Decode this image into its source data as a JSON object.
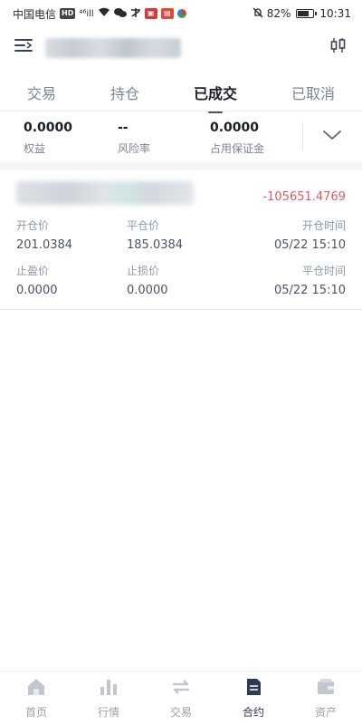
{
  "status_bar": {
    "carrier": "中国电信",
    "hd_badge": "HD",
    "signal_text": "⁴⁶ill",
    "battery": "82%",
    "time": "10:31"
  },
  "tabs": [
    {
      "label": "交易"
    },
    {
      "label": "持仓"
    },
    {
      "label": "已成交",
      "active": true
    },
    {
      "label": "已取消"
    }
  ],
  "summary": {
    "equity": {
      "value": "0.0000",
      "label": "权益"
    },
    "risk_rate": {
      "value": "--",
      "label": "风险率"
    },
    "margin_used": {
      "value": "0.0000",
      "label": "占用保证金"
    }
  },
  "order": {
    "pnl": "-105651.4769",
    "open_price_label": "开仓价",
    "open_price": "201.0384",
    "close_price_label": "平仓价",
    "close_price": "185.0384",
    "open_time_label": "开仓时间",
    "open_time": "05/22 15:10",
    "take_profit_label": "止盈价",
    "take_profit": "0.0000",
    "stop_loss_label": "止损价",
    "stop_loss": "0.0000",
    "close_time_label": "平仓时间",
    "close_time": "05/22 15:10"
  },
  "bottom_nav": [
    {
      "label": "首页",
      "icon": "home-icon"
    },
    {
      "label": "行情",
      "icon": "chart-bars-icon"
    },
    {
      "label": "交易",
      "icon": "swap-icon"
    },
    {
      "label": "合约",
      "icon": "contract-icon",
      "active": true
    },
    {
      "label": "资产",
      "icon": "wallet-icon"
    }
  ],
  "colors": {
    "loss_red": "#e05a66",
    "active_tab_underline": "#48526a",
    "nav_active": "#2f3b55"
  }
}
